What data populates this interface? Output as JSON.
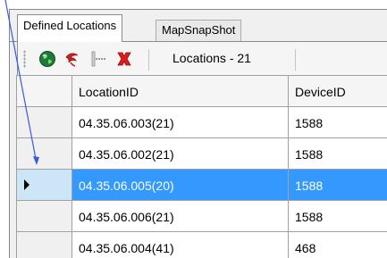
{
  "tabs": [
    {
      "label": "Defined Locations"
    },
    {
      "label": "MapSnapShot"
    }
  ],
  "toolbar": {
    "buttons": [
      {
        "icon": "globe-icon"
      },
      {
        "icon": "red-swirl-icon"
      },
      {
        "icon": "table-grid-icon"
      },
      {
        "icon": "delete-x-icon"
      }
    ],
    "locations_label": "Locations - 21"
  },
  "grid": {
    "columns": [
      "LocationID",
      "DeviceID"
    ],
    "rows": [
      {
        "location_id": "04.35.06.003(21)",
        "device_id": "1588"
      },
      {
        "location_id": "04.35.06.002(21)",
        "device_id": "1588"
      },
      {
        "location_id": "04.35.06.005(20)",
        "device_id": "1588",
        "selected": true
      },
      {
        "location_id": "04.35.06.006(21)",
        "device_id": "1588"
      },
      {
        "location_id": "04.35.06.004(41)",
        "device_id": "468"
      }
    ]
  },
  "colors": {
    "selection": "#3399ff",
    "selection_header": "#cde6f7",
    "pointer_line": "#3b5bdb"
  }
}
